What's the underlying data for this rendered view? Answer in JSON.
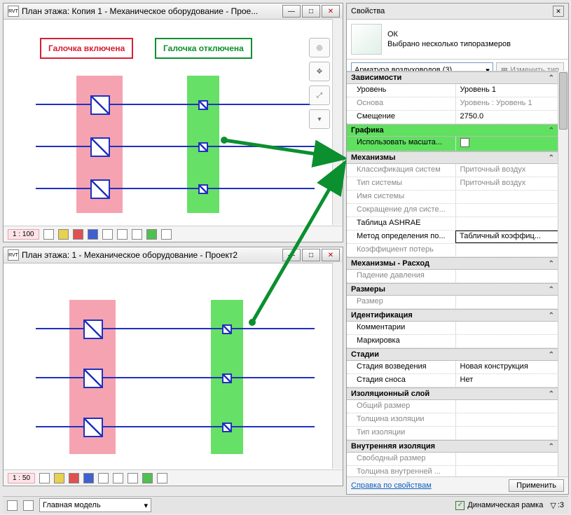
{
  "views": {
    "top": {
      "title": "План этажа: Копия 1 - Механическое оборудование - Прое...",
      "scale": "1 : 100"
    },
    "bottom": {
      "title": "План этажа: 1 - Механическое оборудование - Проект2",
      "scale": "1 : 50"
    }
  },
  "labels": {
    "on": "Галочка включена",
    "off": "Галочка отключена"
  },
  "properties": {
    "panel_title": "Свойства",
    "status": "ОК",
    "status_sub": "Выбрано несколько типоразмеров",
    "selector": "Арматура воздуховодов (3)",
    "edit_type": "Изменить тип",
    "help_link": "Справка по свойствам",
    "apply": "Применить",
    "groups": [
      {
        "label": "Зависимости",
        "rows": [
          {
            "k": "Уровень",
            "v": "Уровень 1"
          },
          {
            "k": "Основа",
            "v": "Уровень : Уровень 1",
            "ro": true
          },
          {
            "k": "Смещение",
            "v": "2750.0"
          }
        ]
      },
      {
        "label": "Графика",
        "hl": true,
        "rows": [
          {
            "k": "Использовать масшта...",
            "v": "",
            "cb": true,
            "hl": true
          }
        ]
      },
      {
        "label": "Механизмы",
        "rows": [
          {
            "k": "Классификация систем",
            "v": "Приточный воздух",
            "ro": true
          },
          {
            "k": "Тип системы",
            "v": "Приточный воздух",
            "ro": true
          },
          {
            "k": "Имя системы",
            "v": "",
            "ro": true
          },
          {
            "k": "Сокращение для систе...",
            "v": "",
            "ro": true
          },
          {
            "k": "Таблица ASHRAE",
            "v": ""
          },
          {
            "k": "Метод определения по...",
            "v": "Табличный коэффиц...",
            "boxed": true
          },
          {
            "k": "Коэффициент потерь",
            "v": "",
            "ro": true
          }
        ]
      },
      {
        "label": "Механизмы - Расход",
        "rows": [
          {
            "k": "Падение давления",
            "v": "",
            "ro": true
          }
        ]
      },
      {
        "label": "Размеры",
        "rows": [
          {
            "k": "Размер",
            "v": "",
            "ro": true
          }
        ]
      },
      {
        "label": "Идентификация",
        "rows": [
          {
            "k": "Комментарии",
            "v": ""
          },
          {
            "k": "Маркировка",
            "v": ""
          }
        ]
      },
      {
        "label": "Стадии",
        "rows": [
          {
            "k": "Стадия возведения",
            "v": "Новая конструкция"
          },
          {
            "k": "Стадия сноса",
            "v": "Нет"
          }
        ]
      },
      {
        "label": "Изоляционный слой",
        "rows": [
          {
            "k": "Общий размер",
            "v": "",
            "ro": true
          },
          {
            "k": "Толщина изоляции",
            "v": "",
            "ro": true
          },
          {
            "k": "Тип изоляции",
            "v": "",
            "ro": true
          }
        ]
      },
      {
        "label": "Внутренняя изоляция",
        "rows": [
          {
            "k": "Свободный размер",
            "v": "",
            "ro": true
          },
          {
            "k": "Толщина внутренней ...",
            "v": "",
            "ro": true
          }
        ]
      }
    ]
  },
  "appbar": {
    "model": "Главная модель",
    "dynframe": "Динамическая рамка",
    "filter": ":3"
  }
}
